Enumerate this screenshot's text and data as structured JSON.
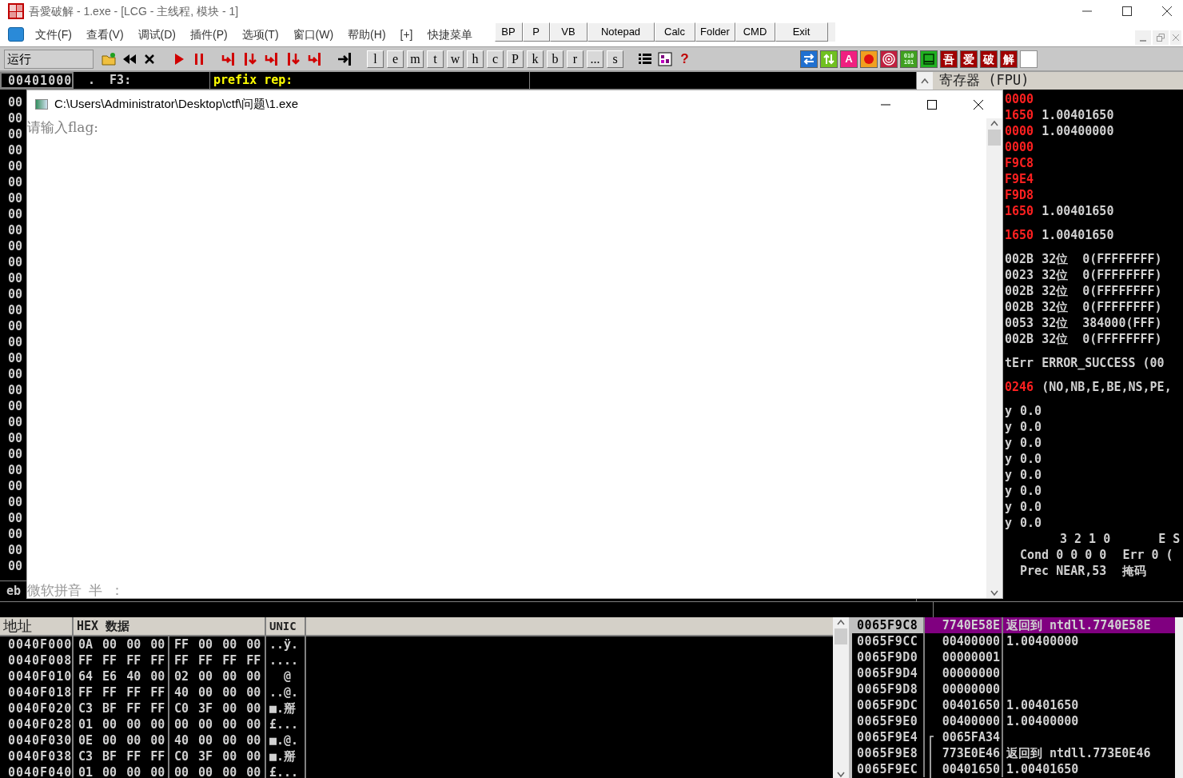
{
  "window": {
    "title": "吾愛破解 - 1.exe - [LCG -  主线程, 模块 - 1]"
  },
  "menu": [
    "文件(F)",
    "查看(V)",
    "调试(D)",
    "插件(P)",
    "选项(T)",
    "窗口(W)",
    "帮助(H)",
    "[+]",
    "快捷菜单"
  ],
  "quick_buttons": [
    "BP",
    "P",
    "VB",
    "Notepad",
    "Calc",
    "Folder",
    "CMD",
    "Exit"
  ],
  "toolbar": {
    "status": "运行",
    "letter_buttons": [
      "l",
      "e",
      "m",
      "t",
      "w",
      "h",
      "c",
      "P",
      "k",
      "b",
      "r",
      "...",
      "s"
    ],
    "help": "?",
    "plugin_icons": [
      {
        "kind": "swap"
      },
      {
        "kind": "bars"
      },
      {
        "kind": "letter",
        "text": "A"
      },
      {
        "kind": "record"
      },
      {
        "kind": "target"
      },
      {
        "kind": "binary",
        "lines": [
          "010",
          "101"
        ]
      },
      {
        "kind": "window"
      },
      {
        "kind": "char",
        "text": "吾"
      },
      {
        "kind": "char",
        "text": "爱"
      },
      {
        "kind": "char",
        "text": "破"
      },
      {
        "kind": "char",
        "text": "解"
      },
      {
        "kind": "blank"
      }
    ]
  },
  "cpu": {
    "address": "00401000",
    "info": ".  F3:",
    "comment": "prefix rep:",
    "rows": [
      "00",
      "00",
      "00",
      "00",
      "00",
      "00",
      "00",
      "00",
      "00",
      "00",
      "00",
      "00",
      "00",
      "00",
      "00",
      "00",
      "00",
      "00",
      "00",
      "00",
      "00",
      "00",
      "00",
      "00",
      "00",
      "00",
      "00",
      "00",
      "00",
      "00"
    ],
    "info_line": "eb"
  },
  "registers": {
    "title": "寄存器 (FPU)",
    "groups": [
      [
        {
          "value": "0000",
          "changed": true
        },
        {
          "value": "1650",
          "changed": true,
          "note": "1.00401650"
        },
        {
          "value": "0000",
          "changed": true,
          "note": "1.00400000"
        },
        {
          "value": "0000",
          "changed": true
        },
        {
          "value": "F9C8",
          "changed": true
        },
        {
          "value": "F9E4",
          "changed": true
        },
        {
          "value": "F9D8",
          "changed": true
        },
        {
          "value": "1650",
          "changed": true,
          "note": "1.00401650"
        }
      ],
      [
        {
          "value": "1650",
          "changed": true,
          "note": "1.00401650"
        }
      ],
      [
        {
          "value": "002B",
          "changed": false,
          "note": "32位  0(FFFFFFFF)"
        },
        {
          "value": "0023",
          "changed": false,
          "note": "32位  0(FFFFFFFF)"
        },
        {
          "value": "002B",
          "changed": false,
          "note": "32位  0(FFFFFFFF)"
        },
        {
          "value": "002B",
          "changed": false,
          "note": "32位  0(FFFFFFFF)"
        },
        {
          "value": "0053",
          "changed": false,
          "note": "32位  384000(FFF)"
        },
        {
          "value": "002B",
          "changed": false,
          "note": "32位  0(FFFFFFFF)"
        }
      ],
      [
        {
          "value": "tErr",
          "changed": false,
          "note": "ERROR_SUCCESS (00"
        }
      ],
      [
        {
          "value": "0246",
          "changed": true,
          "note": "(NO,NB,E,BE,NS,PE,"
        }
      ],
      [
        {
          "value": "y",
          "changed": false,
          "note": "0.0"
        },
        {
          "value": "y",
          "changed": false,
          "note": "0.0"
        },
        {
          "value": "y",
          "changed": false,
          "note": "0.0"
        },
        {
          "value": "y",
          "changed": false,
          "note": "0.0"
        },
        {
          "value": "y",
          "changed": false,
          "note": "0.0"
        },
        {
          "value": "y",
          "changed": false,
          "note": "0.0"
        },
        {
          "value": "y",
          "changed": false,
          "note": "0.0"
        },
        {
          "value": "y",
          "changed": false,
          "note": "0.0"
        }
      ]
    ],
    "fpu_lines": [
      {
        "kind": "head",
        "parts": [
          "3 2 1 0",
          "E S"
        ]
      },
      {
        "kind": "row",
        "parts": [
          "Cond 0 0 0 0",
          "Err 0 ("
        ]
      },
      {
        "kind": "row",
        "parts": [
          "Prec NEAR,53",
          "掩码"
        ]
      }
    ]
  },
  "hex": {
    "columns": [
      "地址",
      "HEX 数据",
      "UNIC"
    ],
    "rows": [
      {
        "address": "0040F000",
        "bytes": [
          "0A",
          "00",
          "00",
          "00",
          "FF",
          "00",
          "00",
          "00"
        ],
        "text": "..ÿ."
      },
      {
        "address": "0040F008",
        "bytes": [
          "FF",
          "FF",
          "FF",
          "FF",
          "FF",
          "FF",
          "FF",
          "FF"
        ],
        "text": "...."
      },
      {
        "address": "0040F010",
        "bytes": [
          "64",
          "E6",
          "40",
          "00",
          "02",
          "00",
          "00",
          "00"
        ],
        "text": "  @"
      },
      {
        "address": "0040F018",
        "bytes": [
          "FF",
          "FF",
          "FF",
          "FF",
          "40",
          "00",
          "00",
          "00"
        ],
        "text": "..@."
      },
      {
        "address": "0040F020",
        "bytes": [
          "C3",
          "BF",
          "FF",
          "FF",
          "C0",
          "3F",
          "00",
          "00"
        ],
        "text": "■.掰"
      },
      {
        "address": "0040F028",
        "bytes": [
          "01",
          "00",
          "00",
          "00",
          "00",
          "00",
          "00",
          "00"
        ],
        "text": "£..."
      },
      {
        "address": "0040F030",
        "bytes": [
          "0E",
          "00",
          "00",
          "00",
          "40",
          "00",
          "00",
          "00"
        ],
        "text": "■.@."
      },
      {
        "address": "0040F038",
        "bytes": [
          "C3",
          "BF",
          "FF",
          "FF",
          "C0",
          "3F",
          "00",
          "00"
        ],
        "text": "■.掰"
      },
      {
        "address": "0040F040",
        "bytes": [
          "01",
          "00",
          "00",
          "00",
          "00",
          "00",
          "00",
          "00"
        ],
        "text": "£..."
      }
    ]
  },
  "stack": {
    "rows": [
      {
        "address": "0065F9C8",
        "value": "7740E58E",
        "comment": "返回到 ntdll.7740E58E",
        "selected": true
      },
      {
        "address": "0065F9CC",
        "value": "00400000",
        "comment": "1.00400000",
        "selected": false
      },
      {
        "address": "0065F9D0",
        "value": "00000001",
        "selected": false
      },
      {
        "address": "0065F9D4",
        "value": "00000000",
        "selected": false
      },
      {
        "address": "0065F9D8",
        "value": "00000000",
        "selected": false
      },
      {
        "address": "0065F9DC",
        "value": "00401650",
        "comment": "1.00401650",
        "selected": false
      },
      {
        "address": "0065F9E0",
        "value": "00400000",
        "comment": "1.00400000",
        "selected": false
      },
      {
        "address": "0065F9E4",
        "value": "0065FA34",
        "selected": false,
        "frame_start": true
      },
      {
        "address": "0065F9E8",
        "value": "773E0E46",
        "comment": "返回到 ntdll.773E0E46",
        "selected": false
      },
      {
        "address": "0065F9EC",
        "value": "00401650",
        "comment": "1.00401650",
        "selected": false
      }
    ]
  },
  "console": {
    "title": "C:\\Users\\Administrator\\Desktop\\ctf\\问题\\1.exe",
    "prompt": "请输入flag:",
    "ime": "微软拼音  半  ："
  }
}
